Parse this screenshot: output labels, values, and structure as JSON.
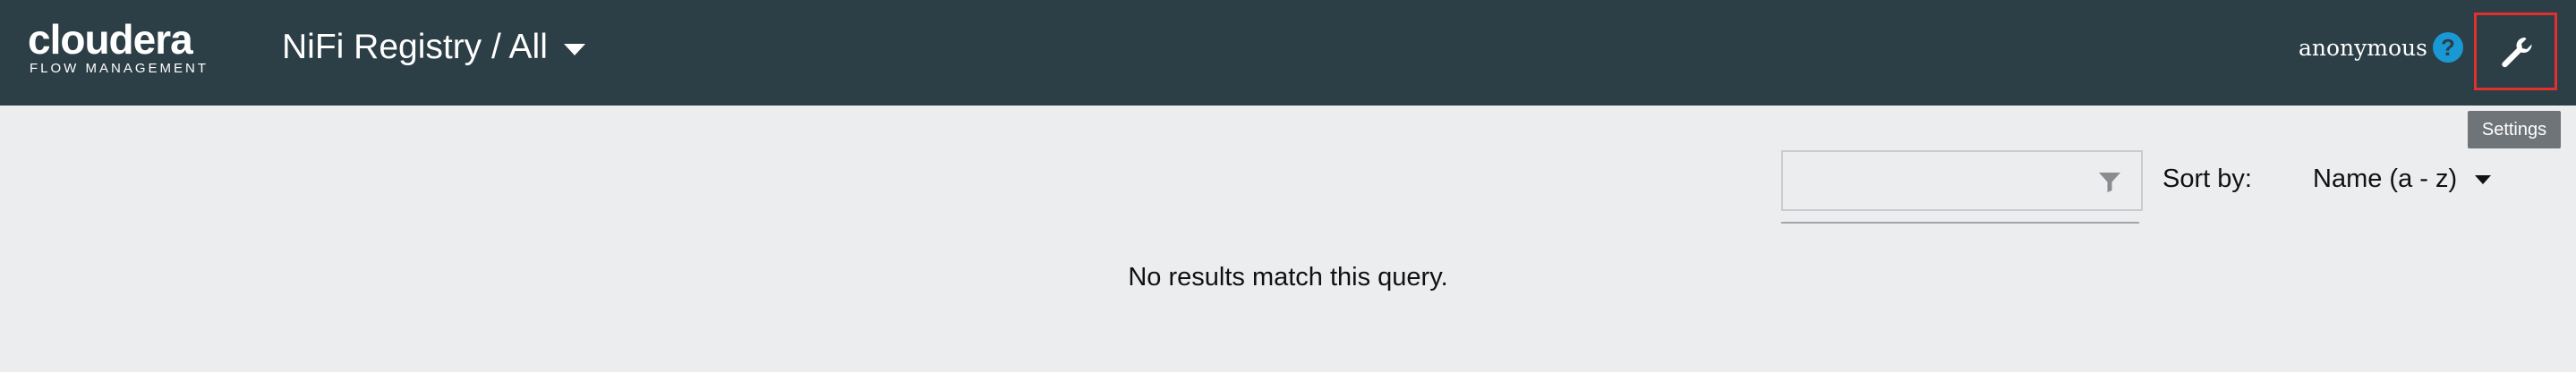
{
  "header": {
    "logo": {
      "main": "cloudera",
      "sub": "FLOW MANAGEMENT"
    },
    "breadcrumb": "NiFi Registry / All",
    "user": "anonymous",
    "help_icon": "?",
    "settings_icon": "wrench-icon",
    "settings_tooltip": "Settings"
  },
  "toolbar": {
    "filter_placeholder": "",
    "filter_icon": "funnel-icon",
    "sort_label": "Sort by:",
    "sort_value": "Name (a - z)"
  },
  "main": {
    "empty_message": "No results match this query."
  },
  "colors": {
    "header_bg": "#2c3e46",
    "page_bg": "#ebedef",
    "help_blue": "#1a98d4",
    "highlight_red": "#e0312e",
    "tooltip_bg": "#6f7478"
  }
}
